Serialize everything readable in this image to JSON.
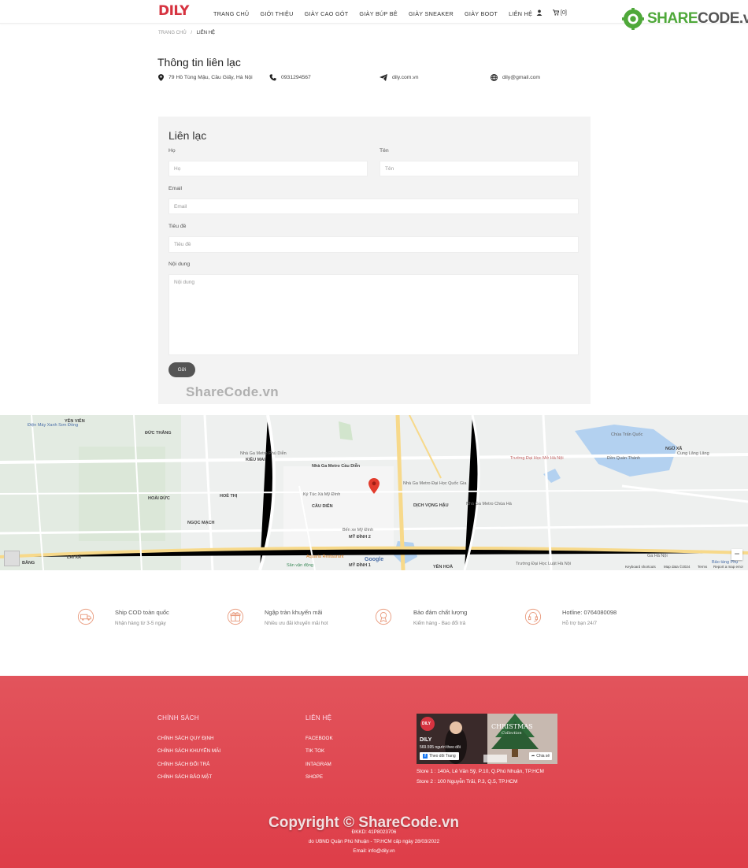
{
  "header": {
    "logo": "DILY",
    "nav": [
      "TRANG CHỦ",
      "GIỚI THIỆU",
      "GIÀY CAO GÓT",
      "GIÀY BÚP BÊ",
      "GIÀY SNEAKER",
      "GIÀY BOOT",
      "LIÊN HỆ"
    ],
    "cart_count": "[0]"
  },
  "watermark_badge": {
    "brand_prefix": "SHARE",
    "brand_suffix": "CODE.vn"
  },
  "breadcrumb": {
    "home": "TRANG CHỦ",
    "separator": "/",
    "current": "LIÊN HỆ"
  },
  "contact_info": {
    "title": "Thông tin liên lạc",
    "address": "79 Hồ Tùng Mậu, Cầu Giấy, Hà Nội",
    "phone": "0931294567",
    "website": "dily.com.vn",
    "email": "dily@gmail.com"
  },
  "form": {
    "title": "Liên lạc",
    "first_name_label": "Họ",
    "first_name_placeholder": "Họ",
    "last_name_label": "Tên",
    "last_name_placeholder": "Tên",
    "email_label": "Email",
    "email_placeholder": "Email",
    "subject_label": "Tiêu đề",
    "subject_placeholder": "Tiêu đề",
    "message_label": "Nội dung",
    "message_placeholder": "Nội dung",
    "submit": "Gửi"
  },
  "watermark_mid": "ShareCode.vn",
  "map": {
    "labels": [
      "YÊN VIÊN",
      "Điện Máy Xanh Sơn Đồng",
      "Nhà Ga Metro Cầu Diễn",
      "Nhà Ga Metro Phú Diễn",
      "Ký Túc Xá Mỹ Đình",
      "CẦU DIỄN",
      "Bến xe Mỹ Đình",
      "MỸ ĐÌNH 2",
      "MỸ ĐÌNH 1",
      "Aquaria Restaurant",
      "Sân vận động",
      "YÊN HOÀ",
      "Trường Đại Học Luật Hà Nội",
      "DỊCH VỌNG HẬU",
      "Nhà Ga Metro Đại Học Quốc Gia",
      "Chùa Trấn Quốc",
      "Đền Quán Thánh",
      "NGŨ XÃ",
      "Cung Lăng Lăng",
      "Ga Hà Nội",
      "HOÀI ĐỨC",
      "NGỌC MẠCH",
      "HOÈ THỊ",
      "Nhà Ga Metro Chùa Hà",
      "Trường Đại Học Mở Hà Nội",
      "ĐỨC THẮNG",
      "KIỀU MAI",
      "LAI XÁ",
      "BẰNG"
    ],
    "google": "Google",
    "keyboard": "Keyboard shortcuts",
    "map_data": "Map data ©2024",
    "terms": "Terms",
    "report": "Report a map error",
    "zoom_out": "−",
    "corner_label": "Bảo tàng Phụ"
  },
  "features": [
    {
      "title": "Ship COD toàn quốc",
      "sub": "Nhận hàng từ 3-5 ngày"
    },
    {
      "title": "Ngập tràn khuyến mãi",
      "sub": "Nhiều ưu đãi khuyến mãi hot"
    },
    {
      "title": "Bảo đảm chất lượng",
      "sub": "Kiểm hàng - Bao đổi trả"
    },
    {
      "title": "Hotline: 0764080098",
      "sub": "Hỗ trợ bạn 24/7"
    }
  ],
  "footer": {
    "policy_heading": "CHÍNH SÁCH",
    "policy_links": [
      "CHÍNH SÁCH QUY ĐỊNH",
      "CHÍNH SÁCH KHUYẾN MÃI",
      "CHÍNH SÁCH ĐỔI TRẢ",
      "CHÍNH SÁCH BẢO MẬT"
    ],
    "contact_heading": "LIÊN HỆ",
    "contact_links": [
      "FACEBOOK",
      "TIK TOK",
      "INTAGRAM",
      "SHOPE"
    ],
    "fb": {
      "page_name": "DILY",
      "followers": "569.595 người theo dõi",
      "follow_btn": "Theo dõi Trang",
      "share_btn": "Chia sẻ",
      "banner_text": "CHRISTMAS",
      "banner_sub": "Collection"
    },
    "store1": "Store 1 : 140A, Lê Văn Sỹ, P.10, Q.Phú Nhuận, TP.HCM",
    "store2": "Store 2 : 100 Nguyễn Trãi, P.3, Q.5, TP.HCM",
    "copyright_wm": "Copyright © ShareCode.vn",
    "dkkd": "ĐKKD: 41P8023706",
    "issued": "do UBND Quận Phú Nhuận - TP.HCM cấp ngày 28/03/2022",
    "email": "Email: info@dily.vn"
  },
  "colors": {
    "brand_red": "#d63340",
    "footer_red": "#e04a53",
    "button": "#555555",
    "form_bg": "#f3f3f3"
  }
}
